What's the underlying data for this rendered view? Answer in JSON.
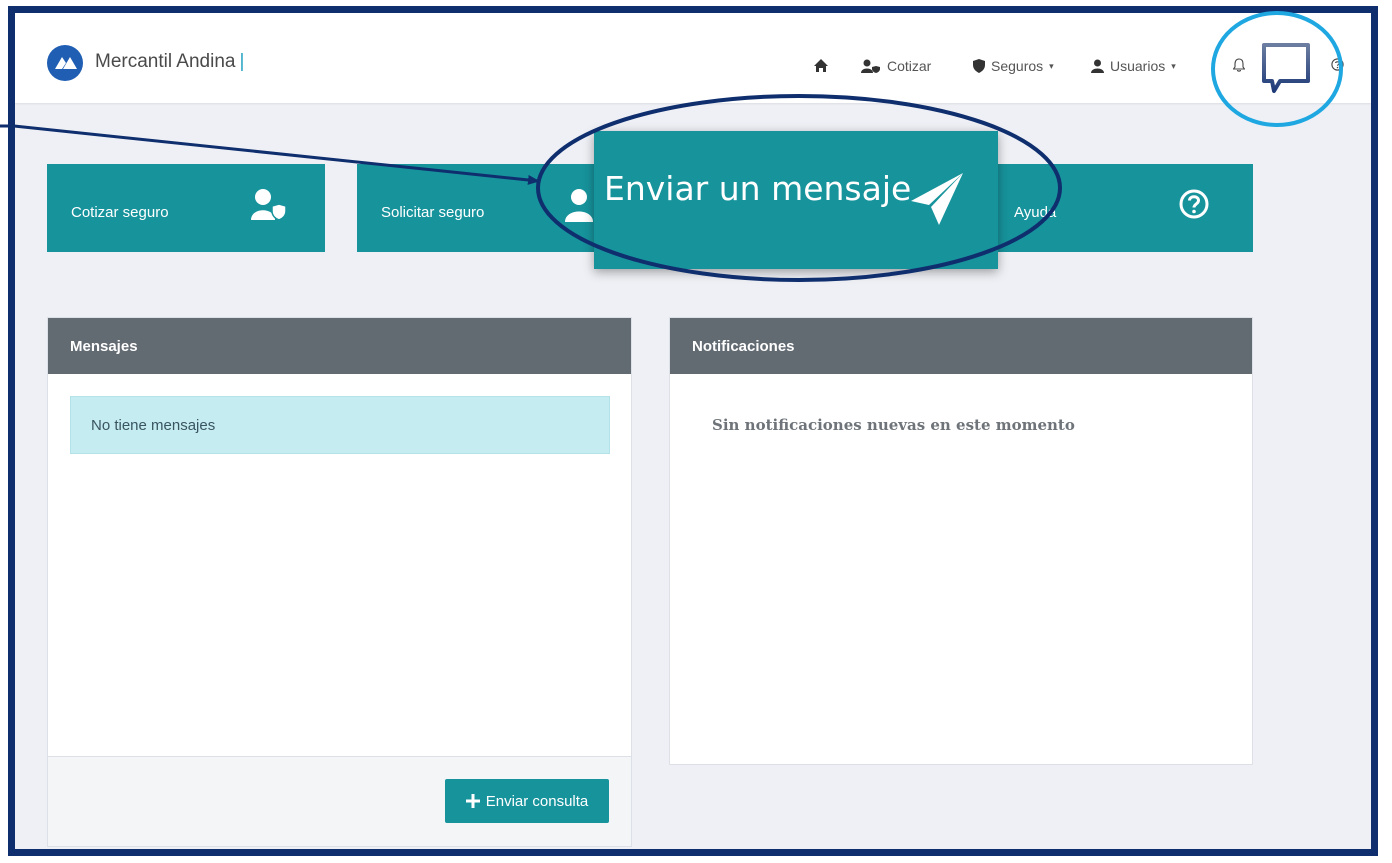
{
  "brand": {
    "name": "Mercantil Andina",
    "separator": "|"
  },
  "nav": {
    "home_icon": "home-icon",
    "cotizar": "Cotizar",
    "seguros": "Seguros",
    "usuarios": "Usuarios",
    "caret": "▾"
  },
  "tiles": {
    "cotizar": "Cotizar seguro",
    "solicitar": "Solicitar seguro",
    "ayuda": "Ayuda"
  },
  "callout": {
    "label": "Enviar un mensaje"
  },
  "messages": {
    "title": "Mensajes",
    "empty_text": "No tiene mensajes",
    "send_button": "Enviar consulta"
  },
  "notifications": {
    "title": "Notificaciones",
    "empty_text": "Sin notificaciones nuevas en este momento"
  },
  "colors": {
    "teal": "#17939c",
    "navy": "#0f2e6e",
    "annotation_cyan": "#1ea7e1",
    "panel_header": "#626a72"
  }
}
